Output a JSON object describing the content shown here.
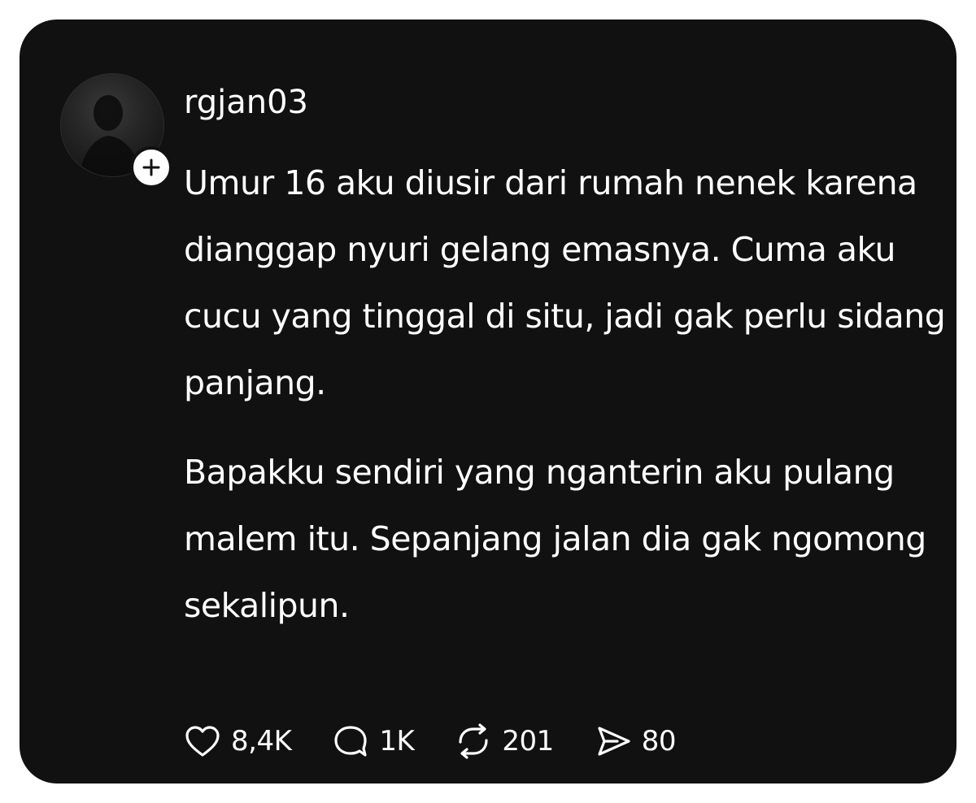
{
  "post": {
    "username": "rgjan03",
    "avatar_alt": "",
    "body": [
      "Umur 16 aku diusir dari rumah nenek karena dianggap nyuri gelang emasnya. Cuma aku cucu yang tinggal di situ, jadi gak perlu sidang panjang.",
      "Bapakku sendiri yang nganterin aku pulang malem itu. Sepanjang jalan dia gak ngomong sekalipun."
    ],
    "actions": {
      "likes": "8,4K",
      "comments": "1K",
      "reposts": "201",
      "shares": "80"
    }
  },
  "icons": {
    "avatar": "profile-photo",
    "follow": "plus-icon",
    "like": "heart-icon",
    "comment": "comment-bubble-icon",
    "repost": "repost-icon",
    "share": "send-icon"
  },
  "colors": {
    "background": "#111111",
    "page": "#ffffff",
    "text": "#ffffff"
  }
}
